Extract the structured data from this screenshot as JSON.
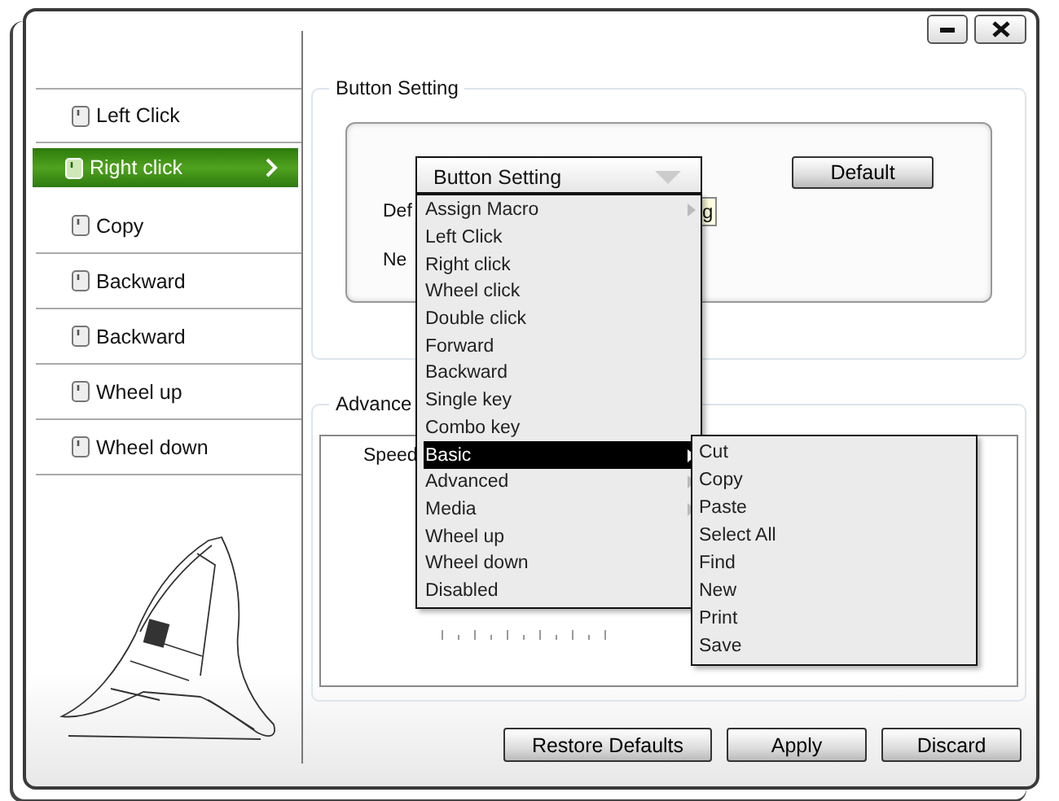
{
  "sidebar": {
    "items": [
      {
        "label": "Left Click",
        "selected": false
      },
      {
        "label": "Right click",
        "selected": true
      },
      {
        "label": "Copy",
        "selected": false
      },
      {
        "label": "Backward",
        "selected": false
      },
      {
        "label": "Backward",
        "selected": false
      },
      {
        "label": "Wheel up",
        "selected": false
      },
      {
        "label": "Wheel down",
        "selected": false
      }
    ]
  },
  "button_setting": {
    "title": "Button Setting",
    "dropdown": {
      "value": "Button Setting",
      "expanded": true
    },
    "default_button": "Default",
    "labels": [
      "Def",
      "Ne"
    ],
    "field_value": "g"
  },
  "menu": {
    "items": [
      {
        "label": "Assign Macro",
        "selected": false,
        "has_submenu": true
      },
      {
        "label": "Left Click",
        "selected": false,
        "has_submenu": false
      },
      {
        "label": "Right click",
        "selected": false,
        "has_submenu": false
      },
      {
        "label": "Wheel click",
        "selected": false,
        "has_submenu": false
      },
      {
        "label": "Double click",
        "selected": false,
        "has_submenu": false
      },
      {
        "label": "Forward",
        "selected": false,
        "has_submenu": false
      },
      {
        "label": "Backward",
        "selected": false,
        "has_submenu": false
      },
      {
        "label": "Single key",
        "selected": false,
        "has_submenu": false
      },
      {
        "label": "Combo key",
        "selected": false,
        "has_submenu": false
      },
      {
        "label": "Basic",
        "selected": true,
        "has_submenu": true
      },
      {
        "label": "Advanced",
        "selected": false,
        "has_submenu": true
      },
      {
        "label": "Media",
        "selected": false,
        "has_submenu": true
      },
      {
        "label": "Wheel up",
        "selected": false,
        "has_submenu": false
      },
      {
        "label": "Wheel down",
        "selected": false,
        "has_submenu": false
      },
      {
        "label": "Disabled",
        "selected": false,
        "has_submenu": false
      }
    ]
  },
  "submenu": {
    "items": [
      "Cut",
      "Copy",
      "Paste",
      "Select All",
      "Find",
      "New",
      "Print",
      "Save"
    ]
  },
  "advanced": {
    "title": "Advance",
    "speed_label": "Speed"
  },
  "buttons": [
    "Restore Defaults",
    "Apply",
    "Discard"
  ]
}
